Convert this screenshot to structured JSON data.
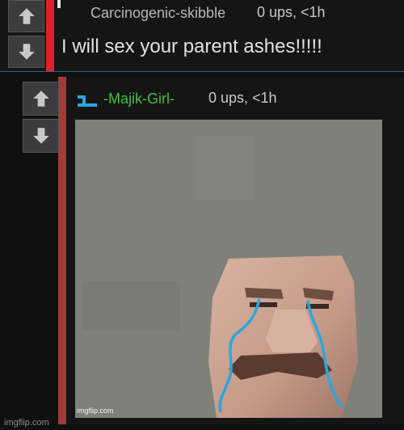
{
  "comments": [
    {
      "author": "Carcinogenic-skibble",
      "votes_meta": "0 ups, <1h",
      "text": "I will sex your parent ashes!!!!!",
      "accent_color": "#e0202a"
    },
    {
      "author": "-Majik-Girl-",
      "votes_meta": "0 ups, <1h",
      "author_color": "#3fbf40",
      "accent_color": "#a23a3a",
      "image": {
        "watermark": "imgflip.com"
      }
    }
  ],
  "icons": [
    "upvote-arrow-icon",
    "downvote-arrow-icon",
    "user-flair-icon"
  ],
  "page_watermark": "imgflip.com"
}
